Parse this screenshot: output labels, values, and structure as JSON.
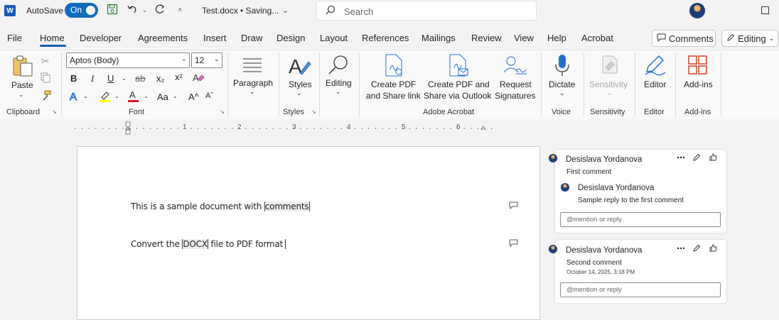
{
  "titlebar": {
    "autosave_label": "AutoSave",
    "autosave_state": "On",
    "doc_title": "Test.docx • Saving...",
    "search_placeholder": "Search"
  },
  "menu": {
    "tabs": [
      "File",
      "Home",
      "Developer",
      "Agreements",
      "Insert",
      "Draw",
      "Design",
      "Layout",
      "References",
      "Mailings",
      "Review",
      "View",
      "Help",
      "Acrobat"
    ],
    "active_tab": "Home",
    "comments_button": "Comments",
    "editing_button": "Editing"
  },
  "ribbon": {
    "clipboard": {
      "paste": "Paste",
      "group": "Clipboard"
    },
    "font": {
      "font_name": "Aptos (Body)",
      "font_size": "12",
      "group": "Font",
      "bold": "B",
      "italic": "I",
      "underline": "U",
      "strike": "ab",
      "subscript": "x₂",
      "superscript": "x²",
      "text_effects": "A",
      "change_case": "Aa",
      "grow": "A^",
      "shrink": "Aˇ"
    },
    "paragraph": {
      "label": "Paragraph"
    },
    "styles": {
      "label": "Styles",
      "group": "Styles"
    },
    "editing": {
      "label": "Editing"
    },
    "acrobat": {
      "create_pdf_link_1": "Create PDF",
      "create_pdf_link_2": "and Share link",
      "create_pdf_outlook_1": "Create PDF and",
      "create_pdf_outlook_2": "Share via Outlook",
      "request_sig_1": "Request",
      "request_sig_2": "Signatures",
      "group": "Adobe Acrobat"
    },
    "voice": {
      "dictate": "Dictate",
      "group": "Voice"
    },
    "sensitivity": {
      "label": "Sensitivity",
      "group": "Sensitivity"
    },
    "editor": {
      "label": "Editor",
      "group": "Editor"
    },
    "addins": {
      "label": "Add-ins",
      "group": "Add-ins"
    },
    "colors": {
      "highlight": "#ffff00",
      "font_color": "#e81123",
      "accent": "#185abd"
    }
  },
  "ruler": {
    "numbers": [
      "1",
      "2",
      "3",
      "4",
      "5",
      "6"
    ]
  },
  "document": {
    "line1_before": "This is a sample document with ",
    "line1_highlight": "comments",
    "line2_before": "Convert the ",
    "line2_highlight": "DOCX",
    "line2_after": " file to PDF format"
  },
  "comments": [
    {
      "author": "Desislava Yordanova",
      "text": "First comment",
      "reply_author": "Desislava Yordanova",
      "reply_text": "Sample reply to the first comment",
      "input_placeholder": "@mention or reply"
    },
    {
      "author": "Desislava Yordanova",
      "text": "Second comment",
      "timestamp": "October 14, 2025, 3:18 PM",
      "input_placeholder": "@mention or reply"
    }
  ]
}
